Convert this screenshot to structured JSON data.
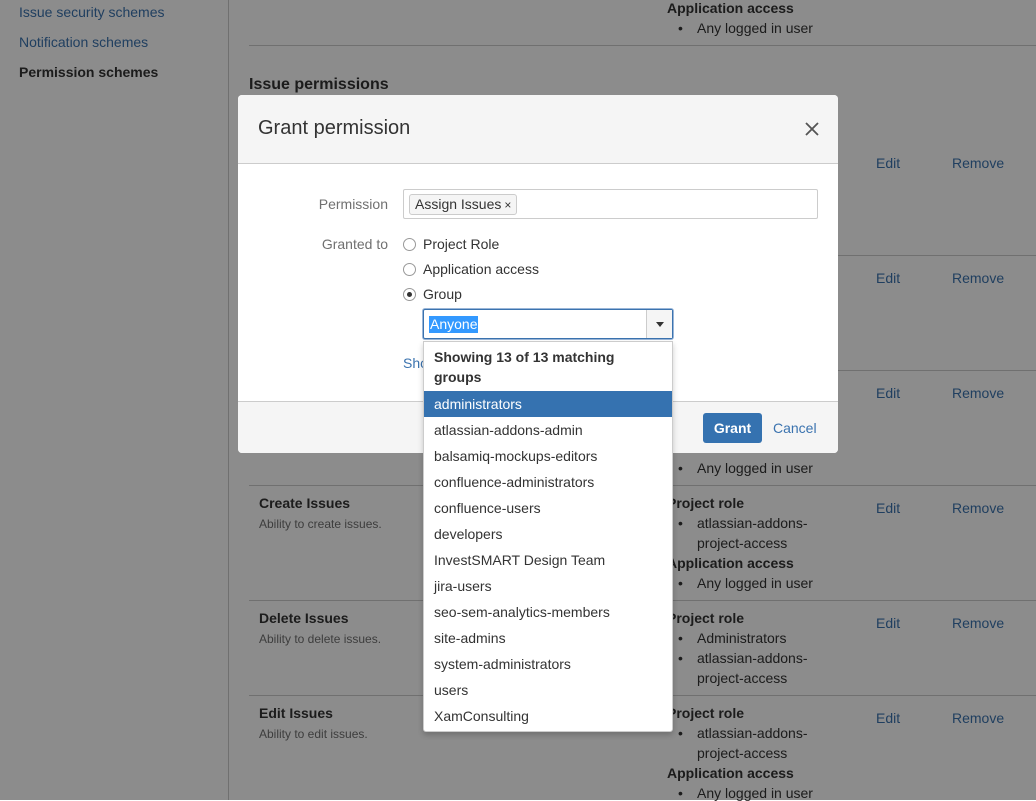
{
  "sidebar": {
    "items": [
      {
        "label": "Issue security schemes"
      },
      {
        "label": "Notification schemes"
      },
      {
        "label": "Permission schemes"
      }
    ]
  },
  "page": {
    "section_title": "Issue permissions",
    "top_grant": {
      "heading": "Application access",
      "item": "Any logged in user"
    },
    "row_actions": {
      "edit": "Edit",
      "remove": "Remove"
    },
    "rows": [
      {
        "name": "Create Issues",
        "description": "Ability to create issues.",
        "grants": [
          {
            "heading": "Project role",
            "items": [
              "atlassian-addons-",
              "project-access"
            ]
          },
          {
            "heading": "Application access",
            "items": [
              "Any logged in user"
            ]
          }
        ]
      },
      {
        "name": "Delete Issues",
        "description": "Ability to delete issues.",
        "grants": [
          {
            "heading": "Project role",
            "items": [
              "Administrators",
              "atlassian-addons-",
              "project-access"
            ]
          }
        ]
      },
      {
        "name": "Edit Issues",
        "description": "Ability to edit issues.",
        "grants": [
          {
            "heading": "Project role",
            "items": [
              "atlassian-addons-",
              "project-access"
            ]
          },
          {
            "heading": "Application access",
            "items": [
              "Any logged in user"
            ]
          }
        ]
      }
    ],
    "partial_row_item": "Any logged in user"
  },
  "dialog": {
    "title": "Grant permission",
    "permission_label": "Permission",
    "permission_token": "Assign Issues",
    "token_remove_glyph": "×",
    "granted_to_label": "Granted to",
    "options": [
      "Project Role",
      "Application access",
      "Group"
    ],
    "selected_option": "Group",
    "group_value": "Anyone",
    "show_link_partial": "Sho",
    "grant_button": "Grant",
    "cancel_link": "Cancel"
  },
  "dropdown": {
    "header": "Showing 13 of 13 matching groups",
    "selected": "administrators",
    "groups": [
      "administrators",
      "atlassian-addons-admin",
      "balsamiq-mockups-editors",
      "confluence-administrators",
      "confluence-users",
      "developers",
      "InvestSMART Design Team",
      "jira-users",
      "seo-sem-analytics-members",
      "site-admins",
      "system-administrators",
      "users",
      "XamConsulting"
    ]
  },
  "colors": {
    "link": "#3b73af",
    "primary_button": "#3572b0",
    "selected_item": "#3572b0",
    "text_selection": "#3399ff"
  }
}
